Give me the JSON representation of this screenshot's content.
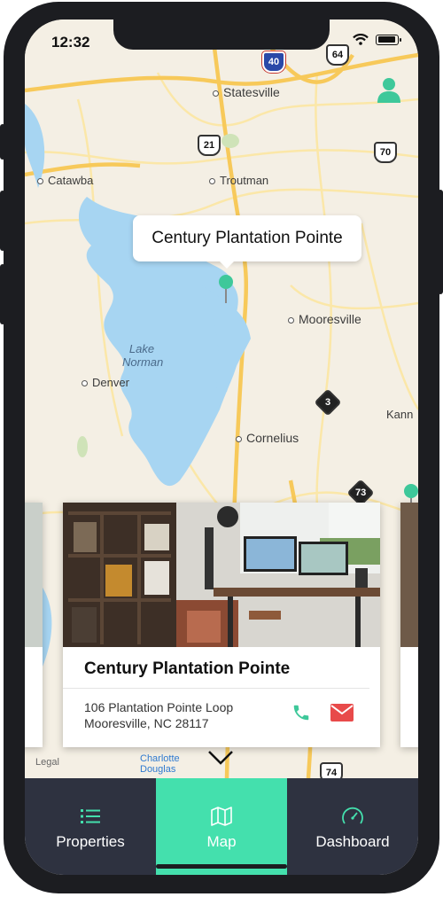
{
  "status_bar": {
    "time": "12:32"
  },
  "map": {
    "places": [
      {
        "name": "Statesville",
        "kind": "city"
      },
      {
        "name": "Catawba",
        "kind": "town"
      },
      {
        "name": "Troutman",
        "kind": "town"
      },
      {
        "name": "Mooresville",
        "kind": "city"
      },
      {
        "name": "Lake Norman",
        "kind": "water"
      },
      {
        "name": "Denver",
        "kind": "town"
      },
      {
        "name": "Cornelius",
        "kind": "city"
      },
      {
        "name": "Kann",
        "kind": "town"
      },
      {
        "name": "Charlotte Douglas",
        "kind": "airport"
      },
      {
        "name": "Legal",
        "kind": "legal"
      }
    ],
    "road_shields": [
      "40",
      "64",
      "21",
      "70",
      "3",
      "73",
      "74"
    ],
    "callout": "Century Plantation Pointe",
    "accent_color": "#44e0ad"
  },
  "property_card": {
    "title": "Century Plantation Pointe",
    "address_line1": "106 Plantation Pointe Loop",
    "address_line2": "Mooresville, NC 28117",
    "call_icon": "phone-icon",
    "email_icon": "envelope-icon"
  },
  "tabs": [
    {
      "label": "Properties",
      "icon": "list-icon",
      "active": false
    },
    {
      "label": "Map",
      "icon": "map-icon",
      "active": true
    },
    {
      "label": "Dashboard",
      "icon": "gauge-icon",
      "active": false
    }
  ]
}
